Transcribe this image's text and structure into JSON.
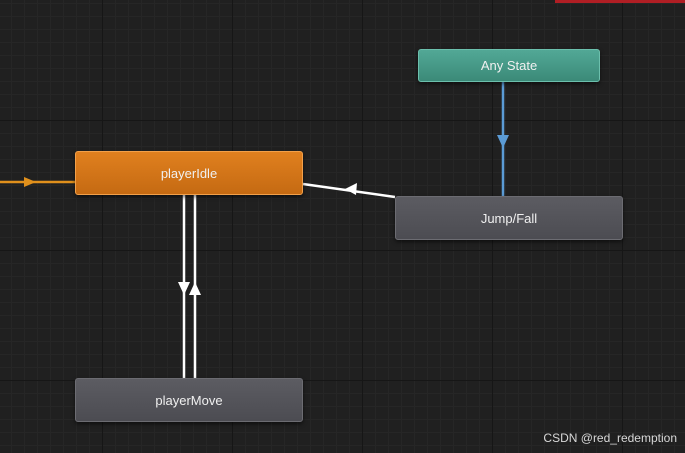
{
  "states": {
    "any_state": "Any State",
    "player_idle": "playerIdle",
    "jump_fall": "Jump/Fall",
    "player_move": "playerMove"
  },
  "watermark": "CSDN @red_redemption",
  "colors": {
    "canvas_background": "#202020",
    "any_state_node": "#3b8a78",
    "default_state_node": "#c56a12",
    "state_node": "#4c4c52",
    "entry_transition": "#e0901c",
    "any_state_transition": "#5b9bd5",
    "transition": "#ffffff",
    "corner_strip": "#b01e24"
  },
  "transitions": [
    {
      "from": "Entry",
      "to": "playerIdle"
    },
    {
      "from": "Any State",
      "to": "Jump/Fall"
    },
    {
      "from": "Jump/Fall",
      "to": "playerIdle"
    },
    {
      "from": "playerIdle",
      "to": "playerMove"
    },
    {
      "from": "playerMove",
      "to": "playerIdle"
    }
  ]
}
